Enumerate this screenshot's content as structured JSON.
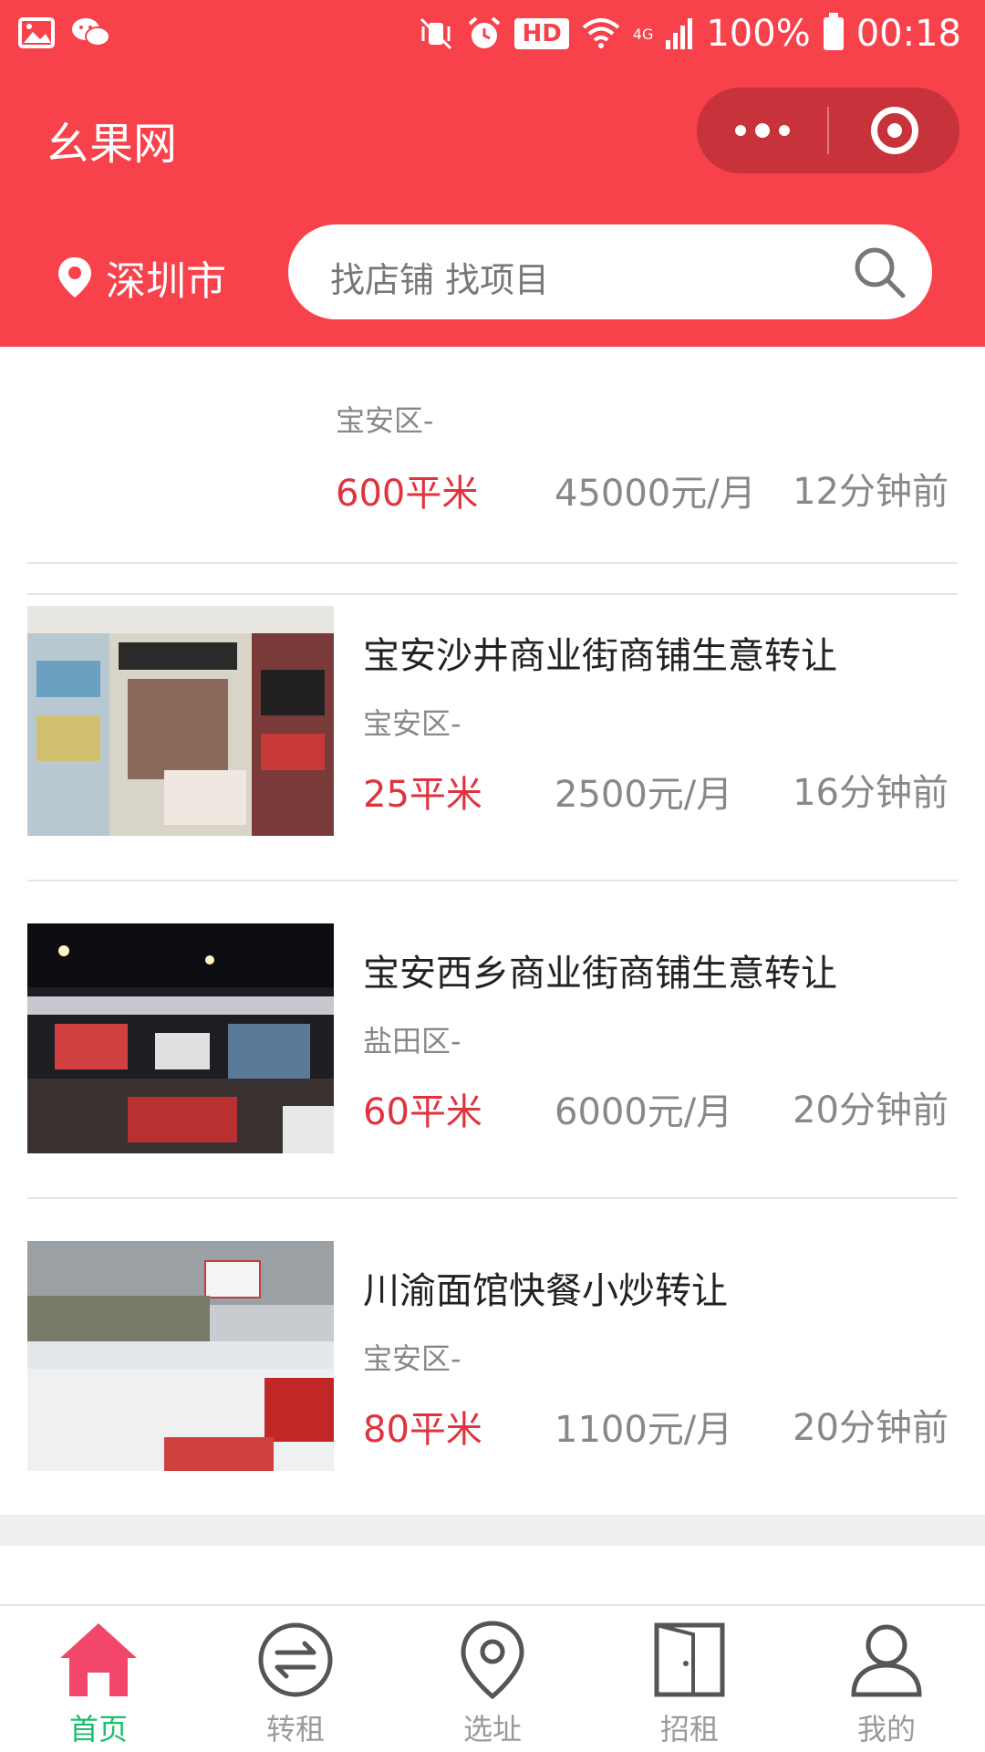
{
  "status_bar": {
    "hd_label": "HD",
    "network_label": "4G",
    "battery": "100%",
    "time": "00:18"
  },
  "header": {
    "title": "幺果网",
    "location": "深圳市",
    "search_placeholder": "找店铺  找项目"
  },
  "listings": [
    {
      "title": "",
      "district": "宝安区-",
      "area": "600平米",
      "price": "45000元/月",
      "time": "12分钟前"
    },
    {
      "title": "宝安沙井商业街商铺生意转让",
      "district": "宝安区-",
      "area": "25平米",
      "price": "2500元/月",
      "time": "16分钟前"
    },
    {
      "title": "宝安西乡商业街商铺生意转让",
      "district": "盐田区-",
      "area": "60平米",
      "price": "6000元/月",
      "time": "20分钟前"
    },
    {
      "title": "川渝面馆快餐小炒转让",
      "district": "宝安区-",
      "area": "80平米",
      "price": "1100元/月",
      "time": "20分钟前"
    }
  ],
  "tabs": [
    {
      "label": "首页",
      "icon": "home-icon",
      "active": true
    },
    {
      "label": "转租",
      "icon": "transfer-icon",
      "active": false
    },
    {
      "label": "选址",
      "icon": "location-pin-icon",
      "active": false
    },
    {
      "label": "招租",
      "icon": "door-icon",
      "active": false
    },
    {
      "label": "我的",
      "icon": "user-icon",
      "active": false
    }
  ],
  "colors": {
    "brand": "#f7414b",
    "area_red": "#e0333e",
    "tab_active": "#1bbf6a",
    "home_icon": "#f2476a"
  }
}
